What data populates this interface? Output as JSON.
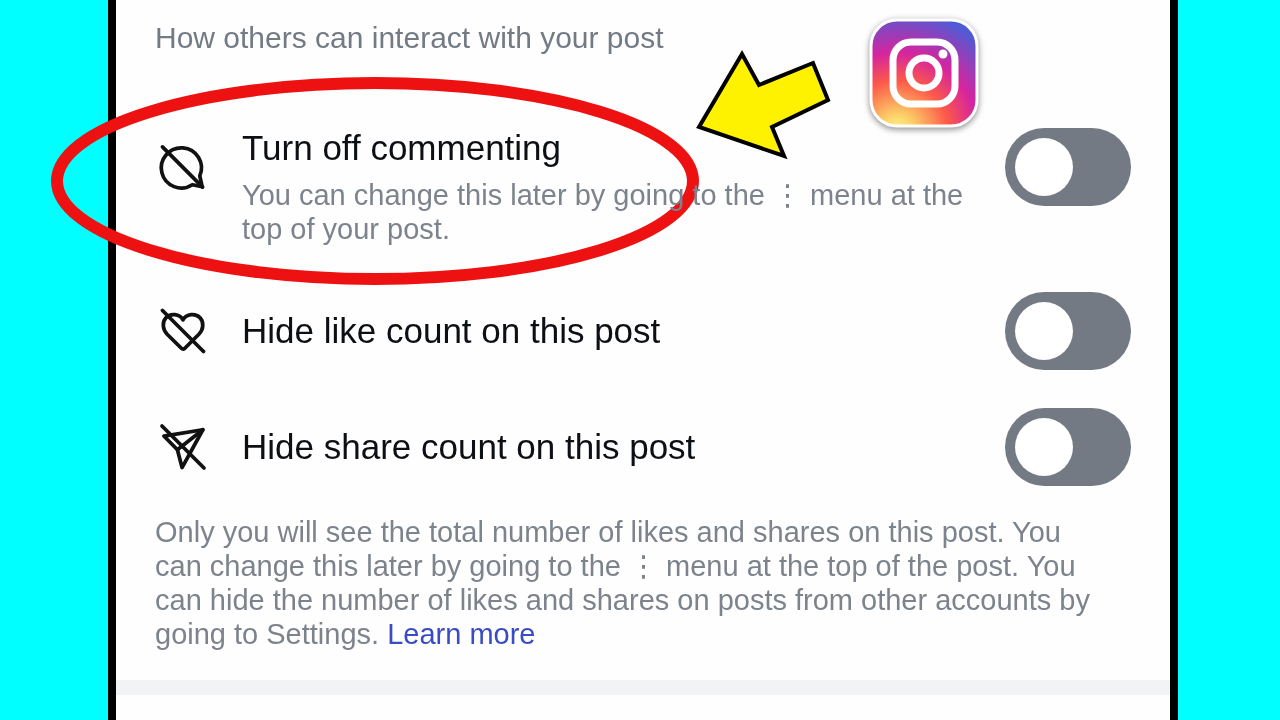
{
  "section_header": "How others can interact with your post",
  "settings": [
    {
      "title": "Turn off commenting",
      "description": "You can change this later by going to the ⋮ menu at the top of your post.",
      "on": false
    },
    {
      "title": "Hide like count on this post",
      "on": false
    },
    {
      "title": "Hide share count on this post",
      "on": false
    }
  ],
  "footer_note": {
    "text": "Only you will see the total number of likes and shares on this post. You can change this later by going to the ⋮ menu at the top of the post. You can hide the number of likes and shares on posts from other accounts by going to Settings.",
    "link": "Learn more"
  }
}
